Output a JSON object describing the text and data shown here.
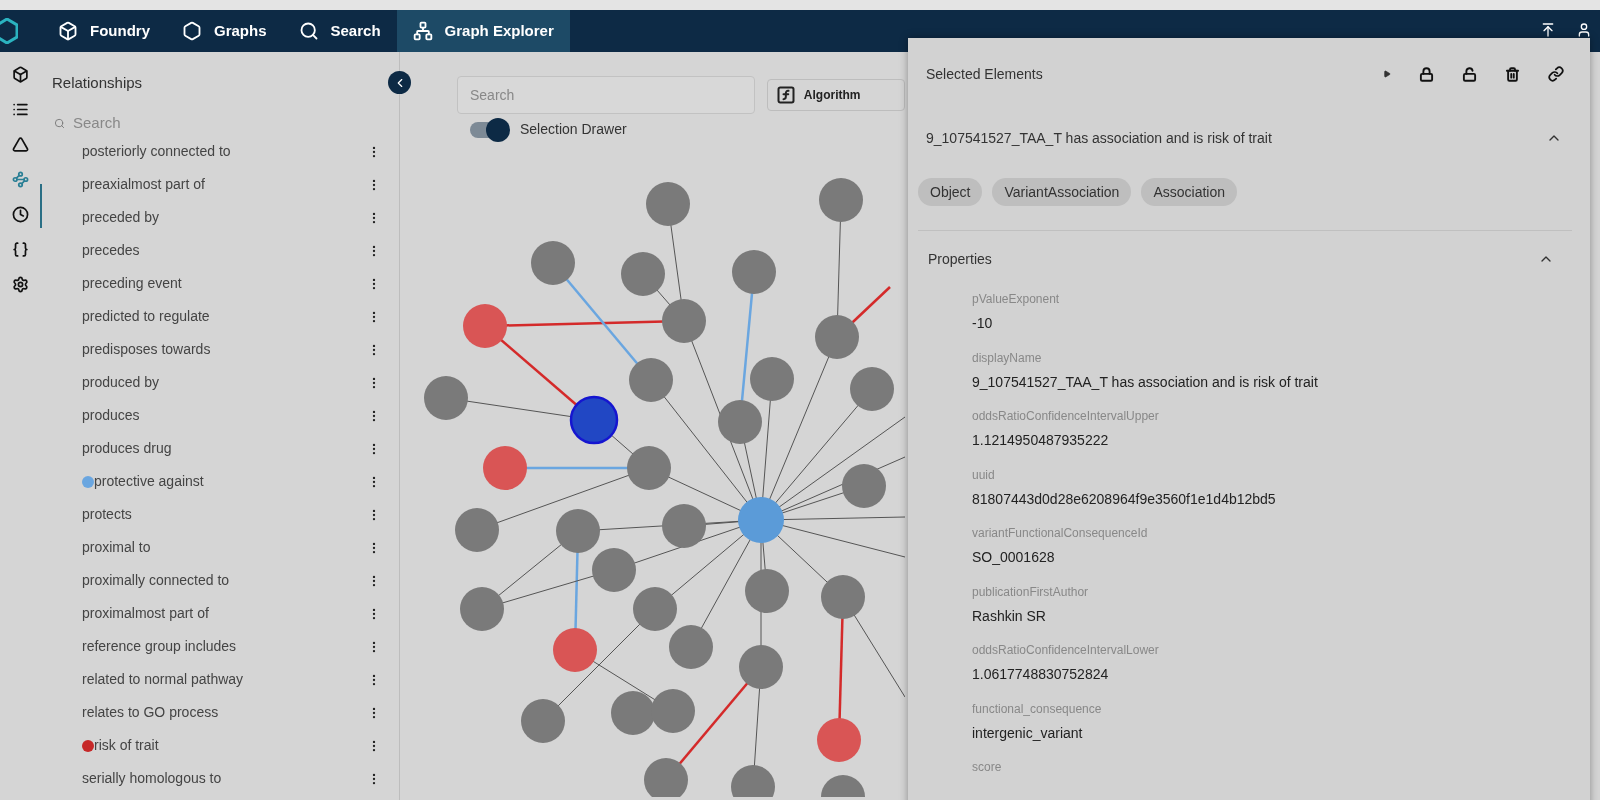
{
  "nav": {
    "items": [
      {
        "kind": "cube",
        "label": "Foundry",
        "selected": false
      },
      {
        "kind": "hexagon",
        "label": "Graphs",
        "selected": false
      },
      {
        "kind": "search",
        "label": "Search",
        "selected": false
      },
      {
        "kind": "network",
        "label": "Graph Explorer",
        "selected": true
      }
    ]
  },
  "rail": {
    "items": [
      {
        "kind": "cube",
        "selected": false
      },
      {
        "kind": "list",
        "selected": false
      },
      {
        "kind": "triangle",
        "selected": false
      },
      {
        "kind": "path",
        "selected": true
      },
      {
        "kind": "clock",
        "selected": false
      },
      {
        "kind": "braces",
        "selected": false
      },
      {
        "kind": "gear",
        "selected": false
      }
    ]
  },
  "sidebar": {
    "title": "Relationships",
    "search": {
      "placeholder": "Search"
    },
    "items": [
      {
        "label": "posteriorly connected to"
      },
      {
        "label": "preaxialmost part of"
      },
      {
        "label": "preceded by"
      },
      {
        "label": "precedes"
      },
      {
        "label": "preceding event"
      },
      {
        "label": "predicted to regulate"
      },
      {
        "label": "predisposes towards"
      },
      {
        "label": "produced by"
      },
      {
        "label": "produces"
      },
      {
        "label": "produces drug"
      },
      {
        "label": "protective against",
        "color": "#6aa6e0"
      },
      {
        "label": "protects"
      },
      {
        "label": "proximal to"
      },
      {
        "label": "proximally connected to"
      },
      {
        "label": "proximalmost part of"
      },
      {
        "label": "reference group includes"
      },
      {
        "label": "related to normal pathway"
      },
      {
        "label": "relates to GO process"
      },
      {
        "label": "risk of trait",
        "color": "#c62828"
      },
      {
        "label": "serially homologous to"
      }
    ]
  },
  "canvas": {
    "search": {
      "placeholder": "Search"
    },
    "algorithm_button": "Algorithm",
    "toggle": {
      "label": "Selection Drawer",
      "on": true
    }
  },
  "panel": {
    "title": "Selected Elements",
    "element": {
      "title": "9_107541527_TAA_T has association and is risk of trait",
      "expanded": true,
      "tags": [
        "Object",
        "VariantAssociation",
        "Association"
      ]
    },
    "properties": {
      "title": "Properties",
      "expanded": true,
      "items": [
        {
          "name": "pValueExponent",
          "value": "-10"
        },
        {
          "name": "displayName",
          "value": "9_107541527_TAA_T has association and is risk of trait"
        },
        {
          "name": "oddsRatioConfidenceIntervalUpper",
          "value": "1.1214950487935222"
        },
        {
          "name": "uuid",
          "value": "81807443d0d28e6208964f9e3560f1e1d4b12bd5"
        },
        {
          "name": "variantFunctionalConsequenceId",
          "value": "SO_0001628"
        },
        {
          "name": "publicationFirstAuthor",
          "value": "Rashkin SR"
        },
        {
          "name": "oddsRatioConfidenceIntervalLower",
          "value": "1.0617748830752824"
        },
        {
          "name": "functional_consequence",
          "value": "intergenic_variant"
        },
        {
          "name": "score"
        }
      ]
    }
  }
}
